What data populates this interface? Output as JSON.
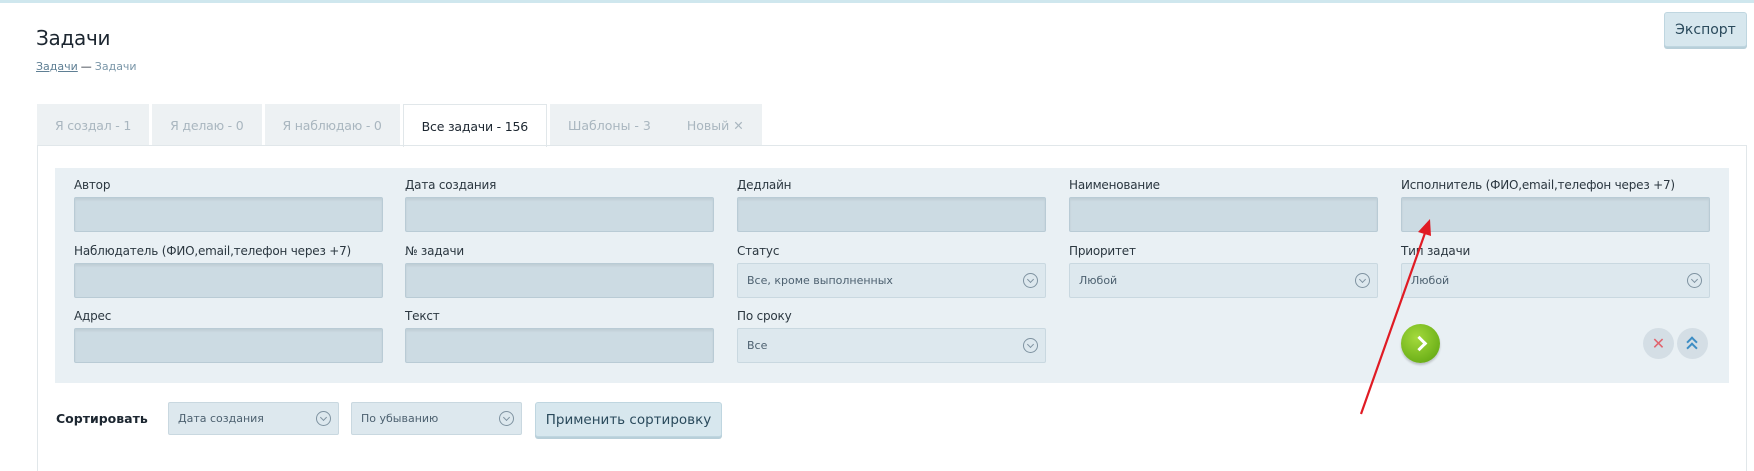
{
  "header": {
    "title": "Задачи",
    "breadcrumb_link": "Задачи",
    "breadcrumb_sep": "—",
    "breadcrumb_current": "Задачи",
    "export_label": "Экспорт"
  },
  "tabs": [
    {
      "label": "Я создал - 1"
    },
    {
      "label": "Я делаю - 0"
    },
    {
      "label": "Я наблюдаю - 0"
    },
    {
      "label": "Все задачи - 156"
    },
    {
      "label": "Шаблоны - 3"
    },
    {
      "label": "Новый"
    }
  ],
  "tab_close_glyph": "✕",
  "filters": {
    "author": {
      "label": "Автор",
      "value": ""
    },
    "created": {
      "label": "Дата создания",
      "value": ""
    },
    "deadline": {
      "label": "Дедлайн",
      "value": ""
    },
    "name": {
      "label": "Наименование",
      "value": ""
    },
    "executor": {
      "label": "Исполнитель (ФИО,email,телефон через +7)",
      "value": ""
    },
    "observer": {
      "label": "Наблюдатель (ФИО,email,телефон через +7)",
      "value": ""
    },
    "number": {
      "label": "№ задачи",
      "value": ""
    },
    "status": {
      "label": "Статус",
      "value": "Все, кроме выполненных"
    },
    "priority": {
      "label": "Приоритет",
      "value": "Любой"
    },
    "type": {
      "label": "Тип задачи",
      "value": "Любой"
    },
    "address": {
      "label": "Адрес",
      "value": ""
    },
    "text": {
      "label": "Текст",
      "value": ""
    },
    "term": {
      "label": "По сроку",
      "value": "Все"
    }
  },
  "filter_clear_glyph": "✕",
  "sort": {
    "label": "Сортировать",
    "field": "Дата создания",
    "order": "По убыванию",
    "apply_label": "Применить сортировку"
  },
  "colors": {
    "accent_green": "#7cbf1e",
    "annotation_red": "#e01b24",
    "panel_bg": "#e9f0f4"
  }
}
